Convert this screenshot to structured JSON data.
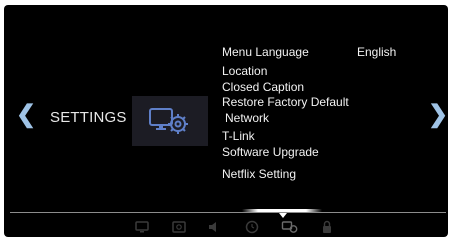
{
  "settings": {
    "title": "SETTINGS",
    "icon": "settings-gear-icon"
  },
  "navigation": {
    "prev_icon": "chevron-left-icon",
    "next_icon": "chevron-right-icon",
    "prev_label": "❮",
    "next_label": "❯"
  },
  "menu": {
    "items": [
      {
        "label": "Menu Language",
        "value": "English"
      },
      {
        "label": "Location"
      },
      {
        "label": "Closed Caption"
      },
      {
        "label": "Restore Factory Default"
      },
      {
        "label": "Network"
      },
      {
        "label": "T-Link"
      },
      {
        "label": "Software Upgrade"
      },
      {
        "label": "Netflix Setting"
      }
    ]
  },
  "bottom_tabs": [
    {
      "icon": "picture-icon"
    },
    {
      "icon": "photo-icon"
    },
    {
      "icon": "sound-icon"
    },
    {
      "icon": "clock-icon"
    },
    {
      "icon": "settings-icon",
      "active": true
    },
    {
      "icon": "lock-icon"
    }
  ],
  "colors": {
    "background": "#000000",
    "arrow": "#9fc3e6",
    "text": "#f2f2f2",
    "tab_icon": "#3a3a3a",
    "active_tab": "#6a6a6a"
  }
}
